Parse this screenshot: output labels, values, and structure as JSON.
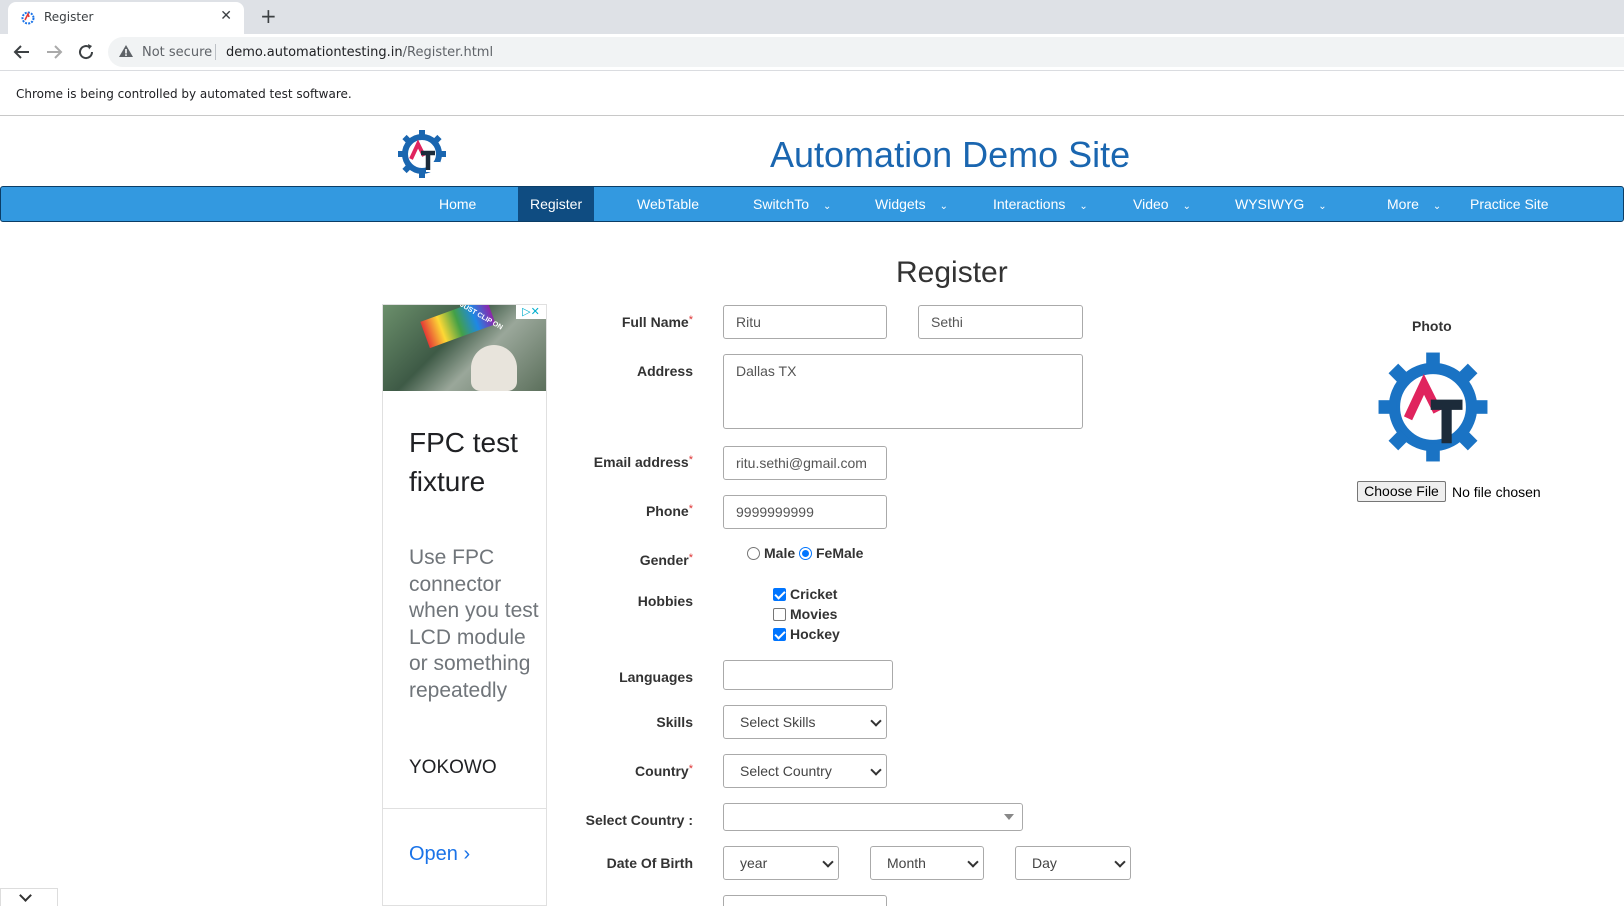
{
  "browser": {
    "tab_title": "Register",
    "tab_close": "✕",
    "new_tab": "+",
    "not_secure": "Not secure",
    "url_host": "demo.automationtesting.in",
    "url_path": "/Register.html",
    "infobar_text": "Chrome is being controlled by automated test software."
  },
  "site": {
    "title": "Automation Demo Site",
    "nav": [
      {
        "label": "Home"
      },
      {
        "label": "Register"
      },
      {
        "label": "WebTable"
      },
      {
        "label": "SwitchTo"
      },
      {
        "label": "Widgets"
      },
      {
        "label": "Interactions"
      },
      {
        "label": "Video"
      },
      {
        "label": "WYSIWYG"
      },
      {
        "label": "More"
      },
      {
        "label": "Practice Site"
      }
    ],
    "accent_color": "#3399e0",
    "active_color": "#0f4c81"
  },
  "form": {
    "heading": "Register",
    "full_name_label": "Full Name",
    "first_name": "Ritu",
    "last_name": "Sethi",
    "address_label": "Address",
    "address": "Dallas TX",
    "email_label": "Email address",
    "email": "ritu.sethi@gmail.com",
    "phone_label": "Phone",
    "phone": "9999999999",
    "gender_label": "Gender",
    "gender_male": "Male",
    "gender_female": "FeMale",
    "hobbies_label": "Hobbies",
    "hobby_cricket": "Cricket",
    "hobby_movies": "Movies",
    "hobby_hockey": "Hockey",
    "languages_label": "Languages",
    "skills_label": "Skills",
    "skills_value": "Select Skills",
    "country_label": "Country",
    "country_value": "Select Country",
    "select_country_label": "Select Country :",
    "dob_label": "Date Of Birth",
    "year_value": "year",
    "month_value": "Month",
    "day_value": "Day",
    "required_mark": "*",
    "selected_gender": "FeMale",
    "checked_hobbies": [
      "Cricket",
      "Hockey"
    ]
  },
  "photo": {
    "label": "Photo",
    "choose_file": "Choose File",
    "no_file": "No file chosen"
  },
  "ad": {
    "headline": "FPC test fixture",
    "body": "Use FPC connector when you test LCD module or something repeatedly",
    "brand": "YOKOWO",
    "cta": "Open ›",
    "image_text": "JUST CLIP ON"
  }
}
